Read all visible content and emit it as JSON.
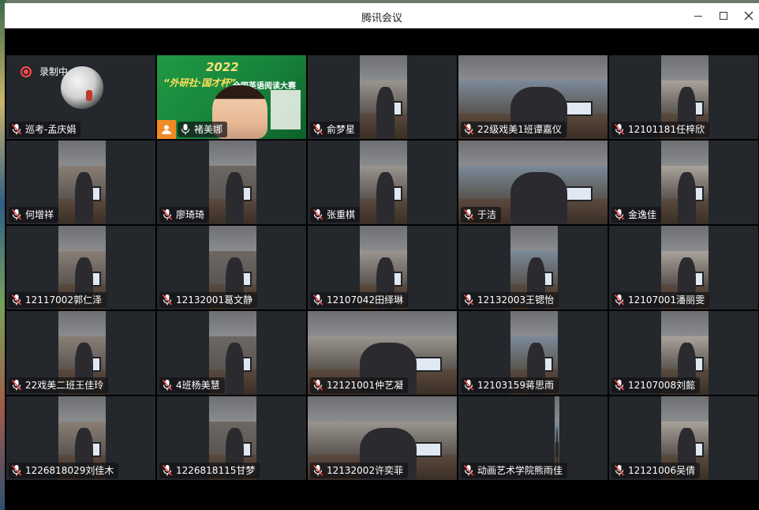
{
  "window": {
    "title": "腾讯会议"
  },
  "recording": {
    "label": "录制中"
  },
  "banner": {
    "year": "2022",
    "title": "“外研社·国才杯”",
    "subtitle": "全国英语阅读大赛"
  },
  "tiles": [
    {
      "name": "巡考-孟庆娟",
      "type": "avatar",
      "mic": "muted"
    },
    {
      "name": "褚美娜",
      "type": "banner",
      "mic": "on"
    },
    {
      "name": "俞梦星",
      "type": "video",
      "mic": "muted"
    },
    {
      "name": "22级戏美1班谭嘉仪",
      "type": "video",
      "mic": "muted"
    },
    {
      "name": "12101181任梓欣",
      "type": "video",
      "mic": "muted"
    },
    {
      "name": "何增祥",
      "type": "video",
      "mic": "muted"
    },
    {
      "name": "廖琦琦",
      "type": "video",
      "mic": "muted"
    },
    {
      "name": "张重棋",
      "type": "video",
      "mic": "muted"
    },
    {
      "name": "于洁",
      "type": "video",
      "mic": "muted"
    },
    {
      "name": "金逸佳",
      "type": "video",
      "mic": "muted"
    },
    {
      "name": "12117002郭仁泽",
      "type": "video",
      "mic": "muted"
    },
    {
      "name": "12132001葛文静",
      "type": "video",
      "mic": "muted"
    },
    {
      "name": "12107042田绎琳",
      "type": "video",
      "mic": "muted"
    },
    {
      "name": "12132003王锶怡",
      "type": "video",
      "mic": "muted"
    },
    {
      "name": "12107001潘丽雯",
      "type": "video",
      "mic": "muted"
    },
    {
      "name": "22戏美二班王佳玲",
      "type": "video",
      "mic": "muted"
    },
    {
      "name": "4班杨美慧",
      "type": "video",
      "mic": "muted"
    },
    {
      "name": "12121001仲艺凝",
      "type": "video",
      "mic": "muted"
    },
    {
      "name": "12103159蒋思雨",
      "type": "video",
      "mic": "muted"
    },
    {
      "name": "12107008刘懿",
      "type": "video",
      "mic": "muted"
    },
    {
      "name": "1226818029刘佳木",
      "type": "video",
      "mic": "muted"
    },
    {
      "name": "1226818115甘梦",
      "type": "video",
      "mic": "muted"
    },
    {
      "name": "12132002许奕菲",
      "type": "video",
      "mic": "muted"
    },
    {
      "name": "动画艺术学院熊雨佳",
      "type": "video",
      "mic": "muted"
    },
    {
      "name": "12121006吴倩",
      "type": "video",
      "mic": "muted"
    }
  ],
  "colors": {
    "tile_bg": "#24272b",
    "record_red": "#ff4a4a",
    "host_orange": "#f08a24"
  }
}
